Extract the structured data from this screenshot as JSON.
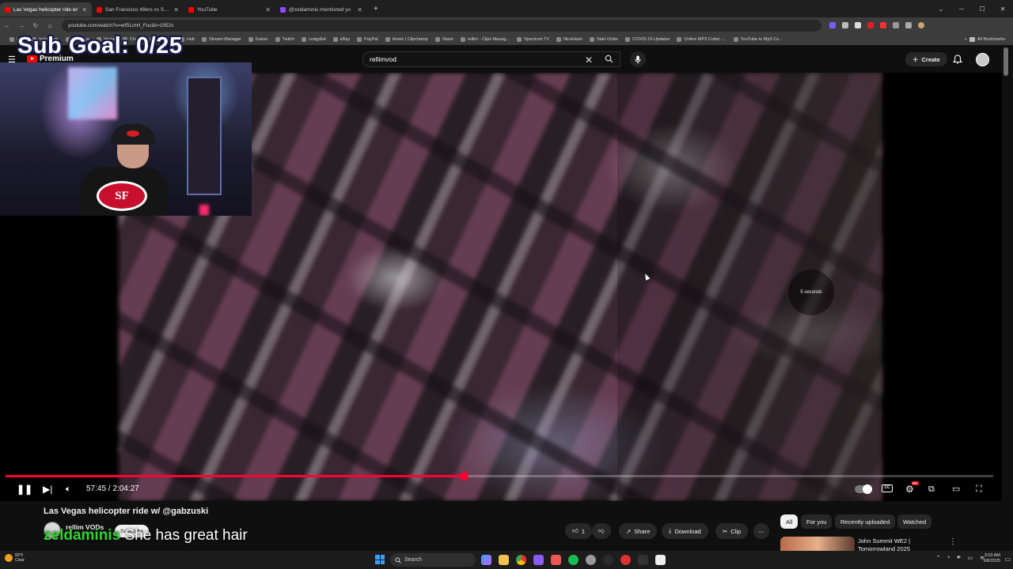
{
  "browser": {
    "tabs": [
      {
        "title": "Las Vegas helicopter ride w/",
        "color": "#ff0000",
        "active": true
      },
      {
        "title": "San Francisco 49ers vs Seattle S",
        "color": "#ff0000",
        "active": false
      },
      {
        "title": "YouTube",
        "color": "#ff0000",
        "active": false
      },
      {
        "title": "@zeldaminis mentioned yo",
        "color": "#9146ff",
        "active": false
      }
    ],
    "new_tab_label": "+",
    "url": "youtube.com/watch?v=wfSLmH_Fuc&t=1952s",
    "bookmarks": [
      "mail",
      "Instagram",
      "YouTube",
      "Home",
      "Chase",
      "Amazon",
      "Hub",
      "Stream Manager",
      "Kaiser",
      "Twitch",
      "craigslist",
      "eBay",
      "PayPal",
      "Home | Clipchamp",
      "Stash",
      "rellim - Clips Manag...",
      "Spectrum TV",
      "NiceHash",
      "Start Order",
      "COVID-19 Updates",
      "Online MP3 Cutter -...",
      "YouTube to Mp3 Co..."
    ],
    "all_bookmarks": "All Bookmarks"
  },
  "youtube": {
    "logo_text": "Premium",
    "search_value": "rellimvod",
    "create_label": "Create"
  },
  "overlay": {
    "sub_goal": "Sub Goal: 0/25"
  },
  "player": {
    "seek_indicator": "5 seconds",
    "time": "57:45 / 2:04:27",
    "progress": 0.464
  },
  "video": {
    "title": "Las Vegas helicopter ride w/ @gabzuski",
    "channel": "rellim VODs",
    "subscribe_label": "Subscribe",
    "like_count": "1",
    "share_label": "Share",
    "download_label": "Download",
    "clip_label": "Clip"
  },
  "caption": {
    "user": "zeldaminis",
    "text": "She has great hair"
  },
  "chips": [
    "All",
    "For you",
    "Recently uploaded",
    "Watched"
  ],
  "recommended": {
    "title": "John Summit WE2 | Tomorrowland 2025"
  },
  "taskbar": {
    "weather_temp": "80°F",
    "weather_desc": "Clear",
    "search_placeholder": "Search",
    "time": "3:03 AM",
    "date": "9/8/2025"
  }
}
